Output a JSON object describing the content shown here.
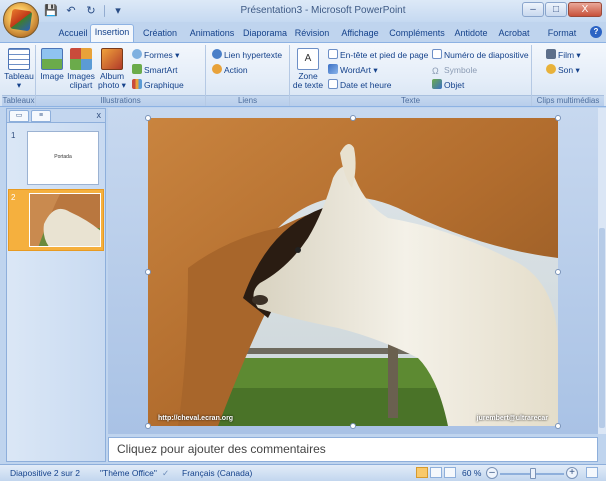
{
  "window": {
    "title": "Présentation3 - Microsoft PowerPoint",
    "minimize": "–",
    "maximize": "□",
    "close": "X"
  },
  "tabs": [
    {
      "label": "Accueil"
    },
    {
      "label": "Insertion",
      "active": true
    },
    {
      "label": "Création"
    },
    {
      "label": "Animations"
    },
    {
      "label": "Diaporama"
    },
    {
      "label": "Révision"
    },
    {
      "label": "Affichage"
    },
    {
      "label": "Compléments"
    },
    {
      "label": "Antidote"
    },
    {
      "label": "Acrobat"
    },
    {
      "label": "Format"
    }
  ],
  "ribbon": {
    "tableaux": {
      "label": "Tableaux",
      "tableau": "Tableau"
    },
    "illustrations": {
      "label": "Illustrations",
      "image": "Image",
      "images_clipart_1": "Images",
      "images_clipart_2": "clipart",
      "album_1": "Album",
      "album_2": "photo ▾",
      "formes": "Formes ▾",
      "smartart": "SmartArt",
      "graphique": "Graphique"
    },
    "liens": {
      "label": "Liens",
      "lien": "Lien hypertexte",
      "action": "Action"
    },
    "texte": {
      "label": "Texte",
      "zone_1": "Zone",
      "zone_2": "de texte",
      "entete": "En-tête et pied de page",
      "wordart": "WordArt ▾",
      "date": "Date et heure",
      "numero": "Numéro de diapositive",
      "symbole": "Symbole",
      "objet": "Objet"
    },
    "multimedia": {
      "label": "Clips multimédias",
      "film": "Film ▾",
      "son": "Son ▾"
    }
  },
  "leftpane": {
    "close": "x",
    "thumb1_num": "1",
    "thumb1_text": "Portada",
    "thumb2_num": "2"
  },
  "slide": {
    "caption_left": "http://cheval.ecran.org",
    "caption_right": "jurembert@ultrarecar"
  },
  "notes": {
    "placeholder": "Cliquez pour ajouter des commentaires"
  },
  "status": {
    "slide": "Diapositive 2 sur 2",
    "theme": "\"Thème Office\"",
    "language": "Français (Canada)",
    "zoom": "60 %"
  }
}
